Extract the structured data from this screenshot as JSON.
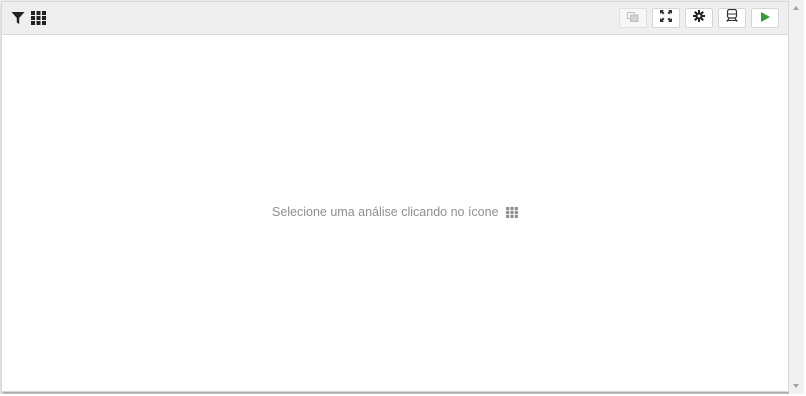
{
  "toolbar": {
    "left_icons": [
      "filter-icon",
      "grid-icon"
    ],
    "right_buttons": [
      {
        "icon": "copy-icon",
        "disabled": true
      },
      {
        "icon": "expand-icon",
        "disabled": false
      },
      {
        "icon": "gear-icon",
        "disabled": false
      },
      {
        "icon": "train-icon",
        "disabled": false
      },
      {
        "icon": "play-icon",
        "disabled": false
      }
    ]
  },
  "content": {
    "empty_message": "Selecione uma análise clicando no ícone",
    "empty_message_icon": "grid-icon"
  },
  "colors": {
    "toolbar_bg": "#efefef",
    "icon_dark": "#222222",
    "play_green": "#3a9a3a",
    "muted_text": "#8f8f8f"
  }
}
